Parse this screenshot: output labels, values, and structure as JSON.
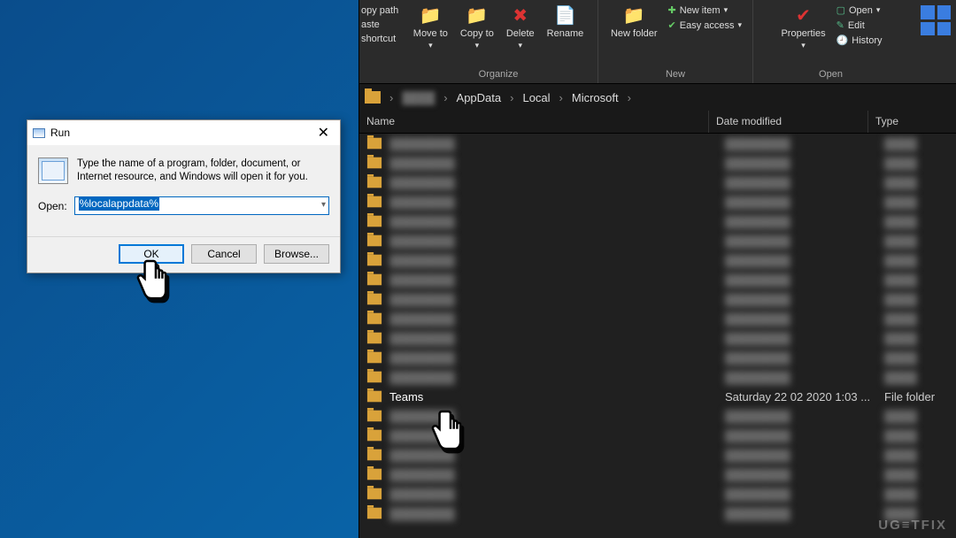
{
  "explorer": {
    "ribbon": {
      "left": {
        "line1": "opy path",
        "line2": "aste shortcut"
      },
      "organize": {
        "label": "Organize",
        "move_to": "Move to",
        "copy_to": "Copy to",
        "delete": "Delete",
        "rename": "Rename"
      },
      "new": {
        "label": "New",
        "new_folder": "New folder",
        "new_item": "New item",
        "easy_access": "Easy access"
      },
      "open": {
        "label": "Open",
        "properties": "Properties",
        "open": "Open",
        "edit": "Edit",
        "history": "History"
      }
    },
    "breadcrumb": [
      "AppData",
      "Local",
      "Microsoft"
    ],
    "columns": {
      "name": "Name",
      "date": "Date modified",
      "type": "Type"
    },
    "teams_row": {
      "name": "Teams",
      "date": "Saturday 22 02 2020 1:03 ...",
      "type": "File folder"
    }
  },
  "run": {
    "title": "Run",
    "description": "Type the name of a program, folder, document, or Internet resource, and Windows will open it for you.",
    "open_label": "Open:",
    "input_value": "%localappdata%",
    "ok": "OK",
    "cancel": "Cancel",
    "browse": "Browse..."
  },
  "watermark": "UG≡TFIX"
}
